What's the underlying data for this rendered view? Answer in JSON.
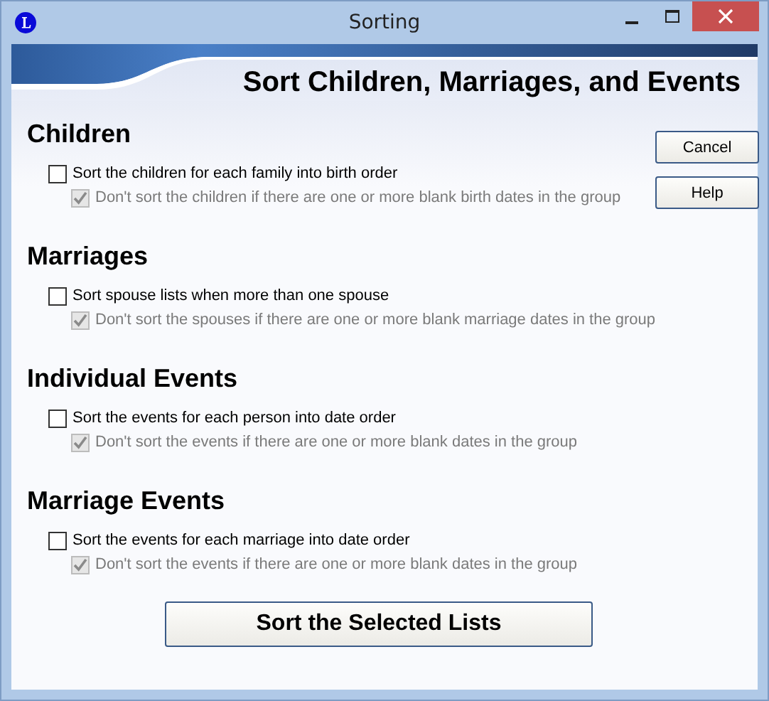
{
  "window": {
    "title": "Sorting"
  },
  "banner": {
    "title": "Sort Children, Marriages, and Events"
  },
  "sections": [
    {
      "heading": "Children",
      "option": {
        "label": "Sort the children for each family into birth order",
        "checked": false
      },
      "sub_option": {
        "label": "Don't sort the children if there are one or more blank birth dates in the group",
        "checked": true,
        "disabled": true
      }
    },
    {
      "heading": "Marriages",
      "option": {
        "label": "Sort spouse lists when more than one spouse",
        "checked": false
      },
      "sub_option": {
        "label": "Don't sort the spouses if there are one or more blank marriage dates in the group",
        "checked": true,
        "disabled": true
      }
    },
    {
      "heading": "Individual Events",
      "option": {
        "label": "Sort the events for each person into date order",
        "checked": false
      },
      "sub_option": {
        "label": "Don't sort the events if there are one or more blank dates in the group",
        "checked": true,
        "disabled": true
      }
    },
    {
      "heading": "Marriage Events",
      "option": {
        "label": "Sort the events for each marriage into date order",
        "checked": false
      },
      "sub_option": {
        "label": "Don't sort the events if there are one or more blank dates in the group",
        "checked": true,
        "disabled": true
      }
    }
  ],
  "side_buttons": [
    "Cancel",
    "Help"
  ],
  "main_button": "Sort the Selected Lists"
}
